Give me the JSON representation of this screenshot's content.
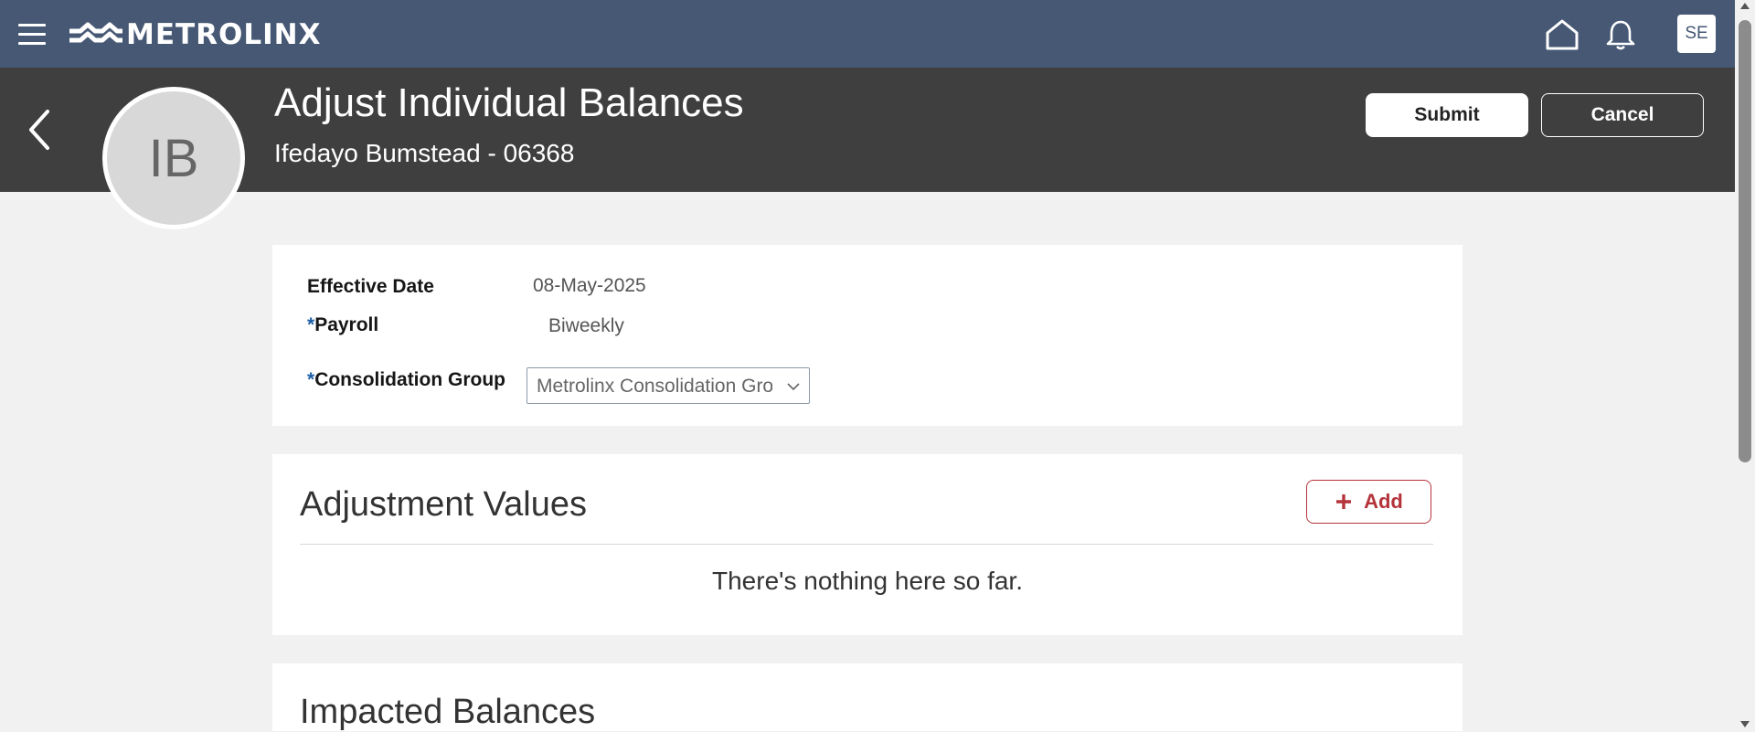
{
  "topnav": {
    "brand": "METROLINX",
    "user_initials": "SE"
  },
  "header": {
    "title": "Adjust Individual Balances",
    "subtitle": "Ifedayo Bumstead - 06368",
    "avatar_initials": "IB",
    "submit_label": "Submit",
    "cancel_label": "Cancel"
  },
  "form": {
    "effective_date_label": "Effective Date",
    "effective_date_value": "08-May-2025",
    "payroll_required_mark": "*",
    "payroll_label": "Payroll",
    "payroll_value": "Biweekly",
    "consolidation_required_mark": "*",
    "consolidation_label": "Consolidation Group",
    "consolidation_value": "Metrolinx Consolidation Group"
  },
  "adjustment_values": {
    "title": "Adjustment Values",
    "add_label": "Add",
    "empty_message": "There's nothing here so far."
  },
  "impacted_balances": {
    "title": "Impacted Balances"
  },
  "icons": [
    "hamburger-menu-icon",
    "metrolinx-logo-icon",
    "home-icon",
    "bell-icon",
    "back-arrow-icon",
    "chevron-down-icon",
    "plus-icon"
  ],
  "colors": {
    "topbar": "#465874",
    "header": "#3f3f3f",
    "accent_red": "#b5333b",
    "required_blue": "#1d5fa6"
  }
}
